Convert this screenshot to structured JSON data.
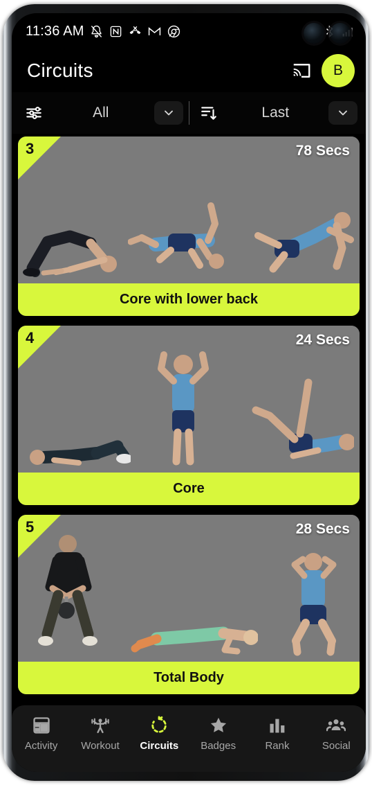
{
  "status_bar": {
    "time": "11:36 AM",
    "left_icons": [
      "bell-muted-icon",
      "nfc-icon",
      "missed-call-icon",
      "gmail-icon",
      "chrome-icon"
    ],
    "right_icons": [
      "bluetooth-icon",
      "cellular-signal-icon"
    ]
  },
  "app_bar": {
    "title": "Circuits",
    "cast_icon": "cast-icon",
    "avatar_initial": "B"
  },
  "filter_bar": {
    "filter_icon": "sliders-icon",
    "filter_value": "All",
    "sort_icon": "sort-descending-icon",
    "sort_value": "Last",
    "chevron_icon": "chevron-down-icon"
  },
  "circuits": [
    {
      "index": "3",
      "duration": "78 Secs",
      "label": "Core with lower back"
    },
    {
      "index": "4",
      "duration": "24 Secs",
      "label": "Core"
    },
    {
      "index": "5",
      "duration": "28 Secs",
      "label": "Total Body"
    }
  ],
  "bottom_nav": {
    "items": [
      {
        "label": "Activity",
        "icon": "dashboard-icon",
        "active": false
      },
      {
        "label": "Workout",
        "icon": "weightlifter-icon",
        "active": false
      },
      {
        "label": "Circuits",
        "icon": "circular-arrow-icon",
        "active": true
      },
      {
        "label": "Badges",
        "icon": "star-icon",
        "active": false
      },
      {
        "label": "Rank",
        "icon": "bar-chart-icon",
        "active": false
      },
      {
        "label": "Social",
        "icon": "people-icon",
        "active": false
      }
    ]
  },
  "colors": {
    "accent": "#d8f73c",
    "card_bg": "#7b7b7b",
    "screen_bg": "#000000",
    "nav_bg": "#171717"
  }
}
